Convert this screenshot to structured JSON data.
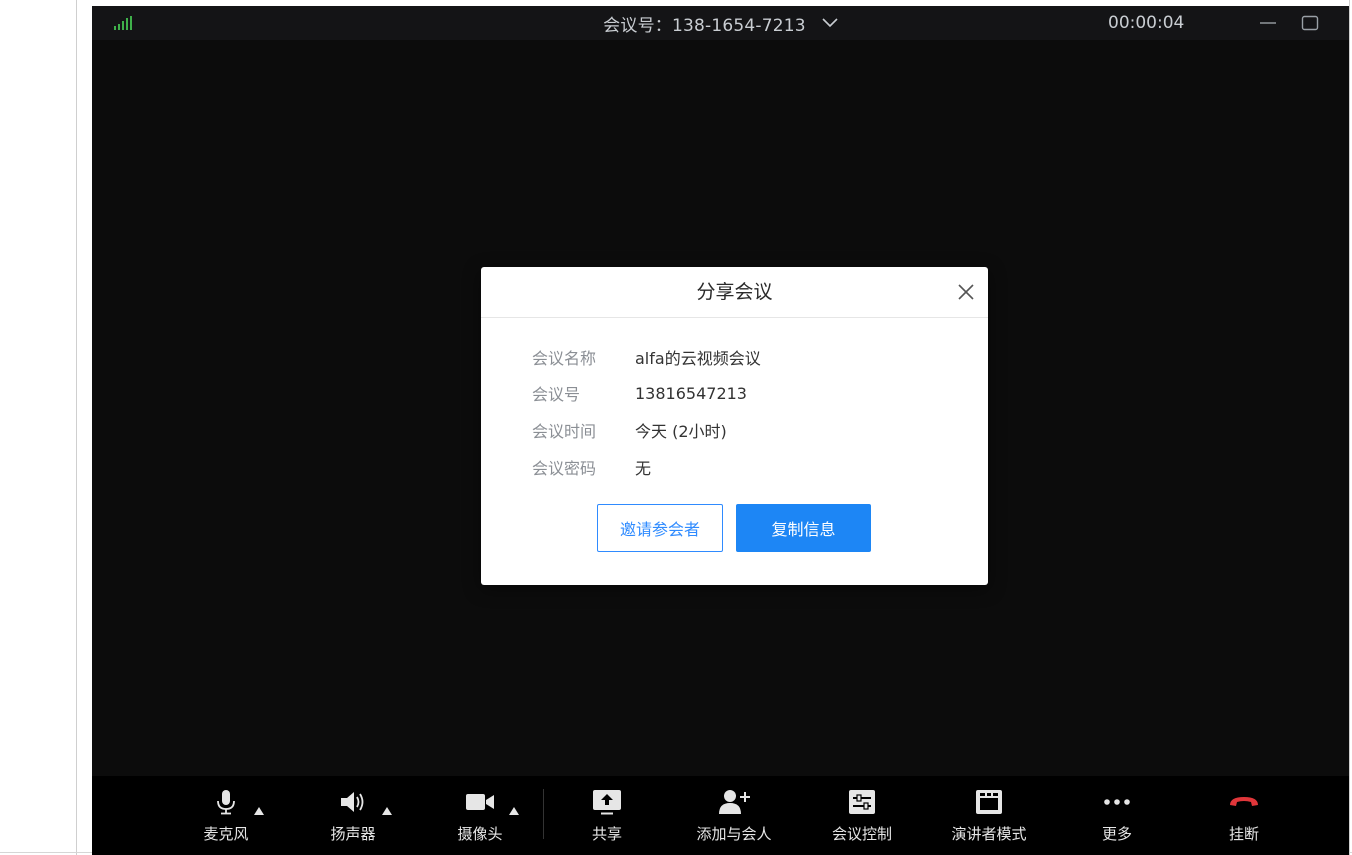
{
  "window": {
    "meeting_id_label": "会议号：138-1654-7213",
    "timer": "00:00:04",
    "signal_icon": "signal-strength-icon"
  },
  "dialog": {
    "title": "分享会议",
    "rows": [
      {
        "key": "会议名称",
        "value": "alfa的云视频会议"
      },
      {
        "key": "会议号",
        "value": "13816547213"
      },
      {
        "key": "会议时间",
        "value": "今天 (2小时)"
      },
      {
        "key": "会议密码",
        "value": "无"
      }
    ],
    "invite_label": "邀请参会者",
    "copy_label": "复制信息"
  },
  "toolbar": {
    "items": [
      {
        "label": "麦克风",
        "icon": "microphone-icon"
      },
      {
        "label": "扬声器",
        "icon": "speaker-icon"
      },
      {
        "label": "摄像头",
        "icon": "camera-icon"
      },
      {
        "label": "共享",
        "icon": "share-screen-icon"
      },
      {
        "label": "添加与会人",
        "icon": "add-participant-icon"
      },
      {
        "label": "会议控制",
        "icon": "meeting-control-icon"
      },
      {
        "label": "演讲者模式",
        "icon": "speaker-mode-icon"
      },
      {
        "label": "更多",
        "icon": "more-icon"
      },
      {
        "label": "挂断",
        "icon": "hang-up-icon"
      }
    ]
  },
  "colors": {
    "window_bg": "#0c0c0c",
    "titlebar_bg": "#141416",
    "toolbar_bg": "#000000",
    "accent_blue": "#1d86f5",
    "signal_green": "#3fb04a",
    "hangup_red": "#e0363a"
  }
}
